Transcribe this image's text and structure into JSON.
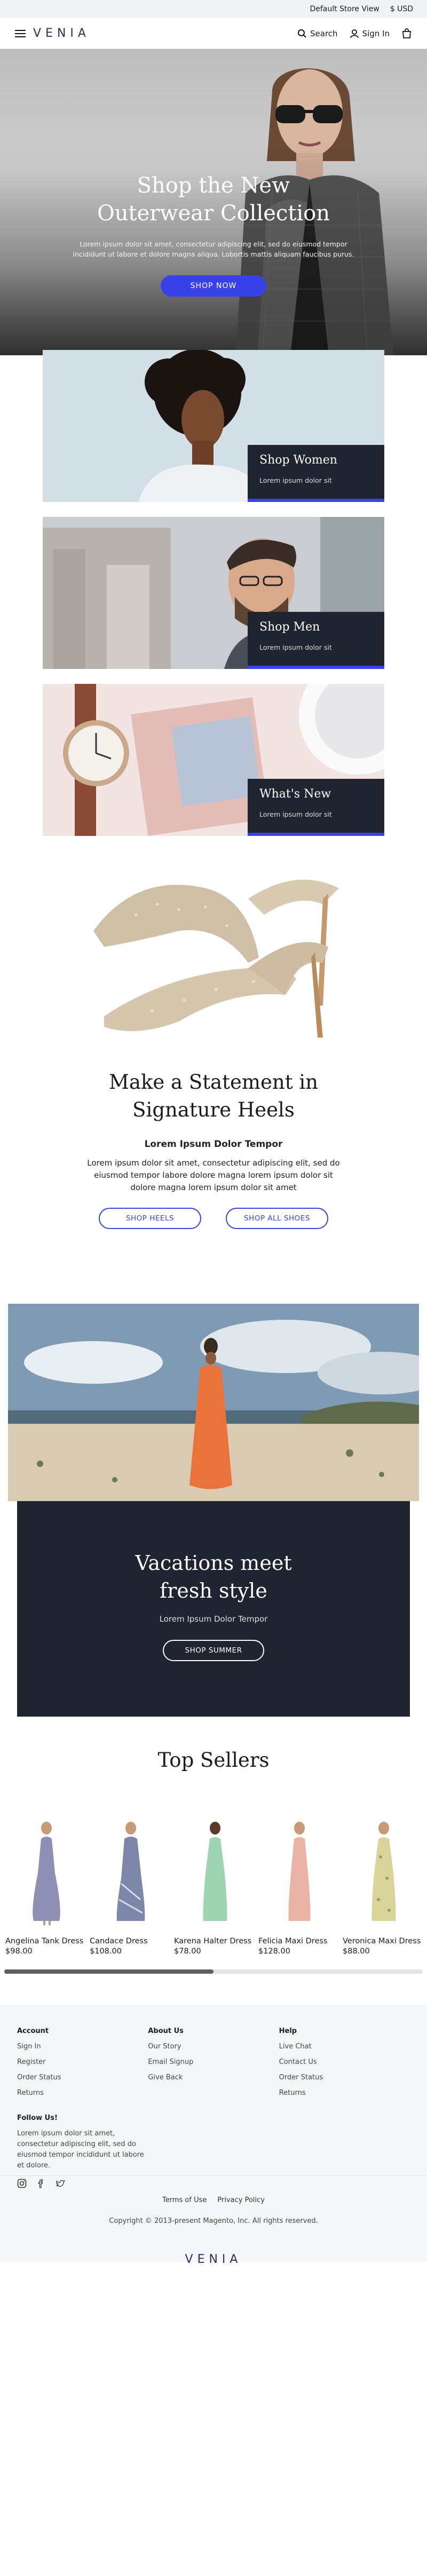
{
  "topbar": {
    "store_view": "Default Store View",
    "currency": "$ USD"
  },
  "header": {
    "logo": "VENIA",
    "search_label": "Search",
    "signin_label": "Sign In"
  },
  "hero": {
    "title_line1": "Shop the New",
    "title_line2": "Outerwear Collection",
    "text": "Lorem ipsum dolor sit amet, consectetur adipiscing elit, sed do eiusmod tempor incididunt ut labore et dolore magna aliqua. Lobortis mattis aliquam faucibus purus.",
    "cta": "SHOP NOW"
  },
  "tiles": [
    {
      "title": "Shop Women",
      "sub": "Lorem ipsum dolor sit"
    },
    {
      "title": "Shop Men",
      "sub": "Lorem ipsum dolor sit"
    },
    {
      "title": "What's New",
      "sub": "Lorem ipsum dolor sit"
    }
  ],
  "heels": {
    "title_line1": "Make a Statement in",
    "title_line2": "Signature Heels",
    "subtitle": "Lorem Ipsum Dolor Tempor",
    "text": "Lorem ipsum dolor sit amet, consectetur adipiscing elit, sed do eiusmod tempor labore dolore magna lorem ipsum dolor sit dolore magna lorem ipsum dolor sit amet",
    "btn_heels": "SHOP HEELS",
    "btn_all": "SHOP ALL SHOES"
  },
  "vacation": {
    "title_line1": "Vacations meet",
    "title_line2": "fresh style",
    "subtitle": "Lorem Ipsum Dolor Tempor",
    "cta": "SHOP SUMMER"
  },
  "top_sellers": {
    "title": "Top Sellers",
    "products": [
      {
        "name": "Angelina Tank Dress",
        "price": "$98.00",
        "color": "#8f8fb5"
      },
      {
        "name": "Candace Dress",
        "price": "$108.00",
        "color": "#7e86a9"
      },
      {
        "name": "Karena Halter Dress",
        "price": "$78.00",
        "color": "#9fd4b3"
      },
      {
        "name": "Felicia Maxi Dress",
        "price": "$128.00",
        "color": "#e9b3a5"
      },
      {
        "name": "Veronica Maxi Dress",
        "price": "$88.00",
        "color": "#d9d49a"
      }
    ],
    "scroll_fraction": 0.5
  },
  "footer": {
    "account": {
      "head": "Account",
      "links": [
        "Sign In",
        "Register",
        "Order Status",
        "Returns"
      ]
    },
    "about": {
      "head": "About Us",
      "links": [
        "Our Story",
        "Email Signup",
        "Give Back"
      ]
    },
    "help": {
      "head": "Help",
      "links": [
        "Live Chat",
        "Contact Us",
        "Order Status",
        "Returns"
      ]
    },
    "follow_head": "Follow Us!",
    "follow_text": "Lorem ipsum dolor sit amet, consectetur adipiscing elit, sed do eiusmod tempor incididunt ut labore et dolore.",
    "terms": "Terms of Use",
    "privacy": "Privacy Policy",
    "copyright": "Copyright © 2013-present Magento, Inc. All rights reserved.",
    "logo": "VENIA"
  }
}
